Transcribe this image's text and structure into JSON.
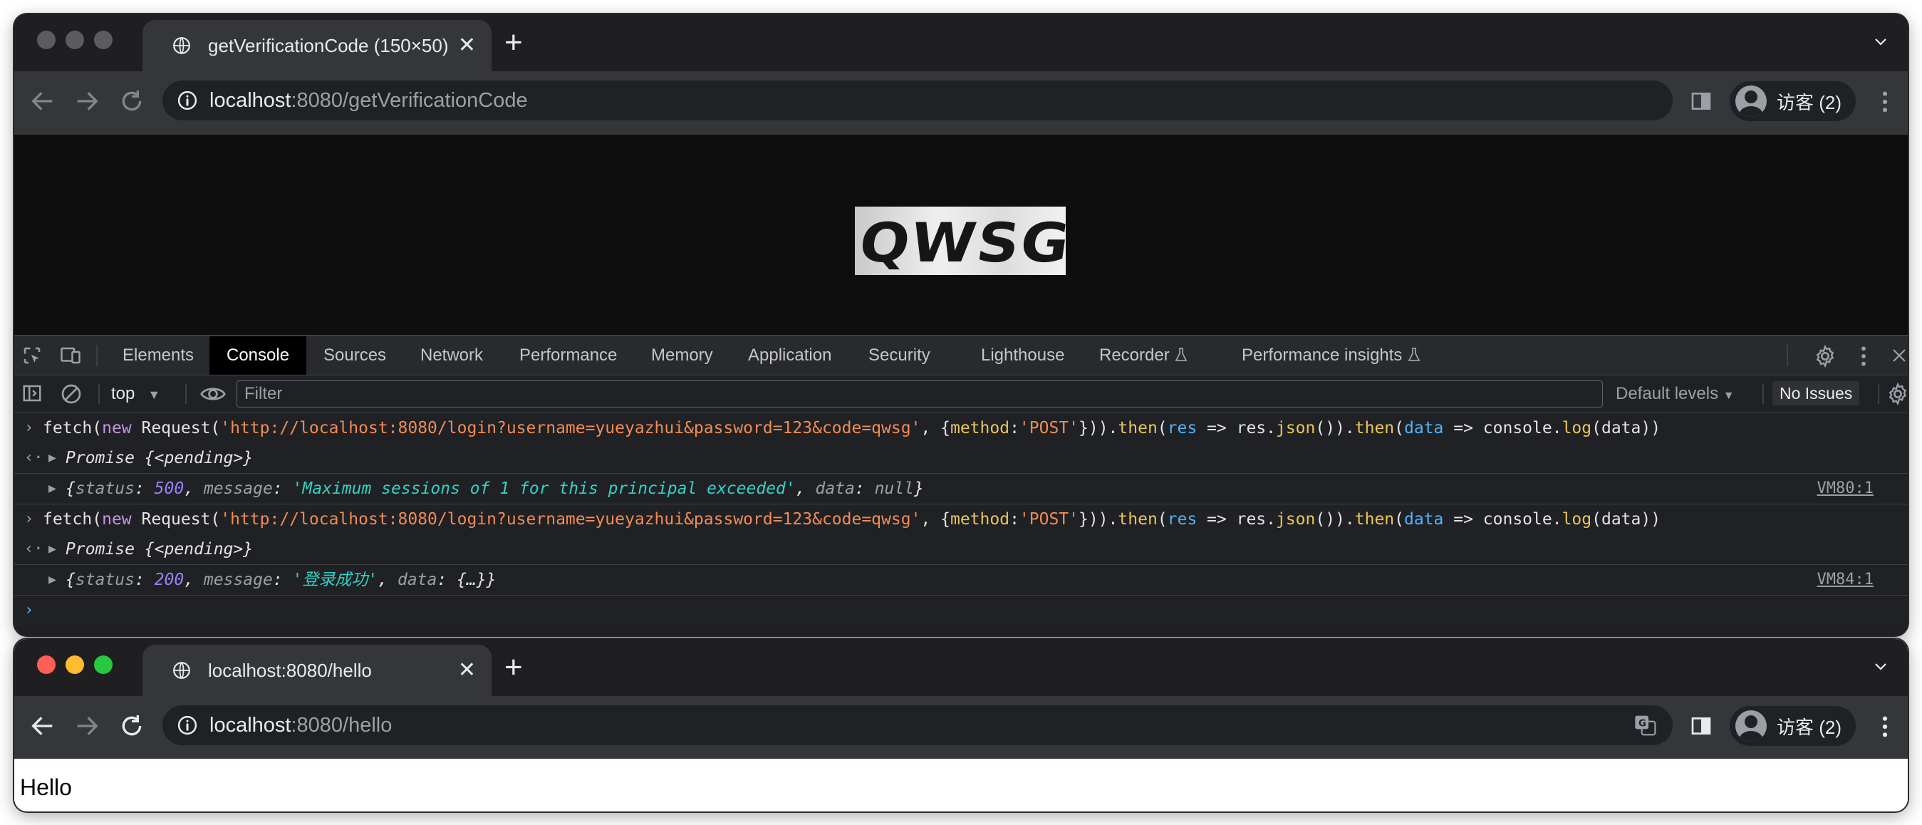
{
  "window1": {
    "tab_title": "getVerificationCode (150×50)",
    "url_host": "localhost",
    "url_rest": ":8080/getVerificationCode",
    "profile_label": "访客 (2)",
    "captcha_text": "QWSG",
    "traffic_light_colors": [
      "#5c5c5e",
      "#5c5c5e",
      "#5c5c5e"
    ]
  },
  "devtools": {
    "tabs": [
      "Elements",
      "Console",
      "Sources",
      "Network",
      "Performance",
      "Memory",
      "Application",
      "Security",
      "Lighthouse",
      "Recorder",
      "Performance insights"
    ],
    "active_tab": "Console",
    "context": "top",
    "filter_placeholder": "Filter",
    "levels": "Default levels",
    "issues": "No Issues",
    "console": {
      "cmd1": {
        "p1": "fetch(",
        "kw_new": "new",
        "p2": " Request(",
        "url": "'http://localhost:8080/login?username=yueyazhui&password=123&code=qwsg'",
        "p3": ", {",
        "method_key": "method",
        "colon": ":",
        "method_val": "'POST'",
        "p4": "})).",
        "then1": "then",
        "p5": "(",
        "res": "res",
        "arrow1": " => res.",
        "json": "json",
        "p6": "()).",
        "then2": "then",
        "p7": "(",
        "data": "data",
        "arrow2": " => console.",
        "log": "log",
        "p8": "(data))"
      },
      "promise1": {
        "name": "Promise",
        "state": "{<pending>}"
      },
      "result1": {
        "open": "{",
        "status_key": "status",
        "status_val": "500",
        "message_key": "message",
        "message_val": "'Maximum sessions of 1 for this principal exceeded'",
        "data_key": "data",
        "data_val": "null",
        "close": "}",
        "source": "VM80:1"
      },
      "cmd2": {
        "p1": "fetch(",
        "kw_new": "new",
        "p2": " Request(",
        "url": "'http://localhost:8080/login?username=yueyazhui&password=123&code=qwsg'",
        "p3": ", {",
        "method_key": "method",
        "colon": ":",
        "method_val": "'POST'",
        "p4": "})).",
        "then1": "then",
        "p5": "(",
        "res": "res",
        "arrow1": " => res.",
        "json": "json",
        "p6": "()).",
        "then2": "then",
        "p7": "(",
        "data": "data",
        "arrow2": " => console.",
        "log": "log",
        "p8": "(data))"
      },
      "promise2": {
        "name": "Promise",
        "state": "{<pending>}"
      },
      "result2": {
        "open": "{",
        "status_key": "status",
        "status_val": "200",
        "message_key": "message",
        "message_val": "'登录成功'",
        "data_key": "data",
        "data_val": "{…}",
        "close": "}",
        "source": "VM84:1"
      }
    }
  },
  "window2": {
    "tab_title": "localhost:8080/hello",
    "url_host": "localhost",
    "url_rest": ":8080/hello",
    "profile_label": "访客 (2)",
    "page_text": "Hello",
    "traffic_light_colors": [
      "#ff5f57",
      "#febc2e",
      "#28c840"
    ]
  }
}
